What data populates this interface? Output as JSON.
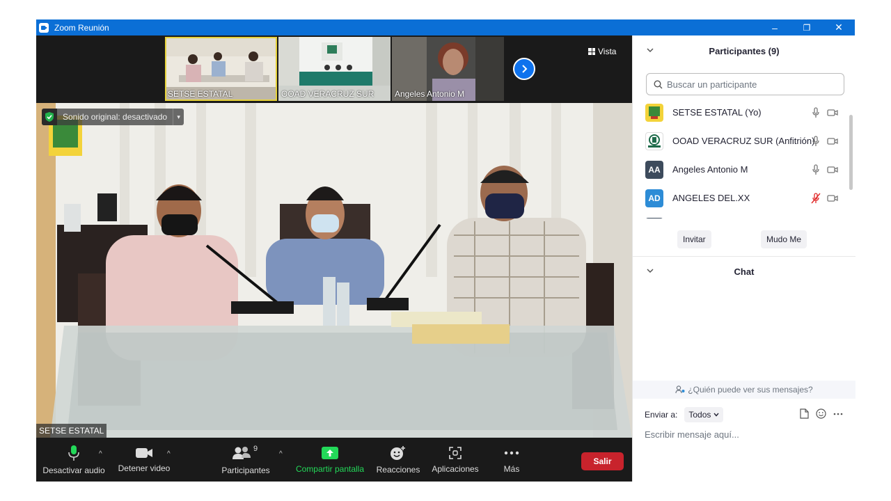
{
  "window": {
    "title": "Zoom Reunión",
    "controls": {
      "minimize": "–",
      "restore": "❐",
      "close": "✕"
    }
  },
  "gallery": {
    "thumbnails": [
      {
        "name": "SETSE ESTATAL",
        "active": true
      },
      {
        "name": "OOAD VERACRUZ SUR",
        "active": false
      },
      {
        "name": "Angeles Antonio M",
        "active": false
      }
    ],
    "next_icon": "chevron-right-icon",
    "view_label": "Vista"
  },
  "main_video": {
    "audio_status": "Sonido original: desactivado",
    "speaker_name": "SETSE ESTATAL"
  },
  "toolbar": {
    "audio_label": "Desactivar audio",
    "video_label": "Detener video",
    "participants_label": "Participantes",
    "participants_count": "9",
    "share_label": "Compartir pantalla",
    "reactions_label": "Reacciones",
    "apps_label": "Aplicaciones",
    "more_label": "Más",
    "leave_label": "Salir",
    "share_color": "#23d959",
    "leave_color": "#c8232c"
  },
  "participants_panel": {
    "title": "Participantes (9)",
    "search_placeholder": "Buscar un participante",
    "participants": [
      {
        "name": "SETSE ESTATAL (Yo)",
        "avatar": "",
        "avatar_kind": "logo-setse",
        "muted": false
      },
      {
        "name": "OOAD VERACRUZ SUR (Anfitrión)",
        "avatar": "",
        "avatar_kind": "logo-imss",
        "muted": false
      },
      {
        "name": "Angeles Antonio M",
        "avatar": "AA",
        "avatar_color": "#3d4b5c",
        "muted": false
      },
      {
        "name": "ANGELES DEL.XX",
        "avatar": "AD",
        "avatar_color": "#2d8cd6",
        "muted": true
      }
    ],
    "invite_label": "Invitar",
    "mute_me_label": "Mudo Me"
  },
  "chat_panel": {
    "title": "Chat",
    "who_can_see": "¿Quién puede ver sus mensajes?",
    "send_to_label": "Enviar a:",
    "send_to_value": "Todos",
    "message_placeholder": "Escribir mensaje aquí..."
  }
}
